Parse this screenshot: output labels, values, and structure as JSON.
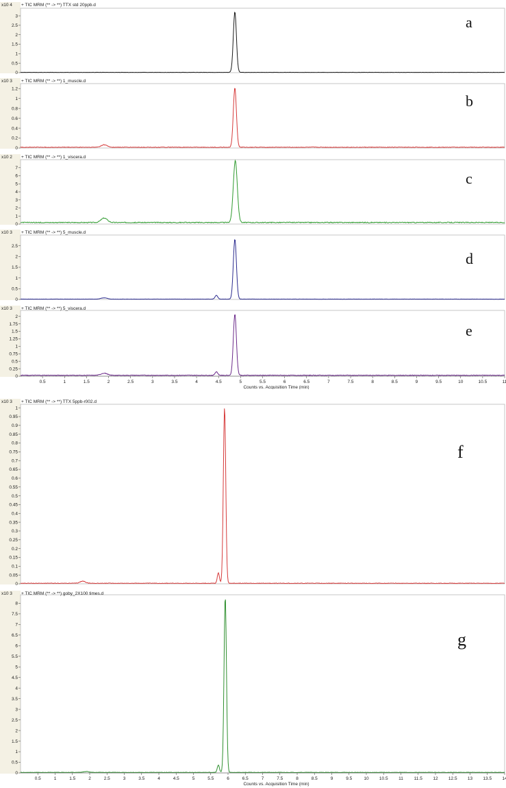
{
  "chart_data": [
    {
      "type": "line",
      "label": "a",
      "header": "+ TIC MRM (** -> **) TTX std 20ppb.d",
      "exponent": "x10 4",
      "y_ticks": [
        "0",
        "0.5",
        "1",
        "1.5",
        "2",
        "2.5",
        "3"
      ],
      "ylim": [
        0,
        3.4
      ],
      "xlim": [
        0,
        11
      ],
      "color": "#1a1a1a",
      "peaks": [
        {
          "x": 4.87,
          "y": 3.2,
          "w": 0.035
        }
      ],
      "baseline": 0.015,
      "noise": 0.006
    },
    {
      "type": "line",
      "label": "b",
      "header": "+ TIC MRM (** -> **) 1_muscle.d",
      "exponent": "x10 3",
      "y_ticks": [
        "0",
        "0.2",
        "0.4",
        "0.6",
        "0.8",
        "1",
        "1.2"
      ],
      "ylim": [
        0,
        1.3
      ],
      "xlim": [
        0,
        11
      ],
      "color": "#d63a3a",
      "peaks": [
        {
          "x": 1.9,
          "y": 0.05,
          "w": 0.07
        },
        {
          "x": 4.87,
          "y": 1.2,
          "w": 0.035
        }
      ],
      "baseline": 0.015,
      "noise": 0.006
    },
    {
      "type": "line",
      "label": "c",
      "header": "+ TIC MRM (** -> **) 1_viscera.d",
      "exponent": "x10 2",
      "y_ticks": [
        "0",
        "1",
        "2",
        "3",
        "4",
        "5",
        "6",
        "7"
      ],
      "ylim": [
        0,
        8
      ],
      "xlim": [
        0,
        11
      ],
      "color": "#2e9a2e",
      "peaks": [
        {
          "x": 1.9,
          "y": 0.55,
          "w": 0.07
        },
        {
          "x": 4.88,
          "y": 7.7,
          "w": 0.045
        }
      ],
      "baseline": 0.2,
      "noise": 0.05
    },
    {
      "type": "line",
      "label": "d",
      "header": "+ TIC MRM (** -> **) 5_muscle.d",
      "exponent": "x10 3",
      "y_ticks": [
        "0",
        "0.5",
        "1",
        "1.5",
        "2",
        "2.5"
      ],
      "ylim": [
        0,
        3.0
      ],
      "xlim": [
        0,
        11
      ],
      "color": "#2a2a8e",
      "peaks": [
        {
          "x": 1.9,
          "y": 0.06,
          "w": 0.07
        },
        {
          "x": 4.45,
          "y": 0.18,
          "w": 0.03
        },
        {
          "x": 4.87,
          "y": 2.8,
          "w": 0.035
        }
      ],
      "baseline": 0.015,
      "noise": 0.006
    },
    {
      "type": "line",
      "label": "e",
      "header": "+ TIC MRM (** -> **) 5_viscera.d",
      "exponent": "x10 3",
      "y_ticks": [
        "0",
        "0.25",
        "0.5",
        "0.75",
        "1",
        "1.25",
        "1.5",
        "1.75",
        "2"
      ],
      "ylim": [
        0,
        2.2
      ],
      "xlim": [
        0,
        11
      ],
      "color": "#6b2a8a",
      "peaks": [
        {
          "x": 1.9,
          "y": 0.07,
          "w": 0.07
        },
        {
          "x": 4.45,
          "y": 0.12,
          "w": 0.03
        },
        {
          "x": 4.87,
          "y": 2.05,
          "w": 0.035
        }
      ],
      "baseline": 0.03,
      "noise": 0.01,
      "x_ticks": [
        "0.5",
        "1",
        "1.5",
        "2",
        "2.5",
        "3",
        "3.5",
        "4",
        "4.5",
        "5",
        "5.5",
        "6",
        "6.5",
        "7",
        "7.5",
        "8",
        "8.5",
        "9",
        "9.5",
        "10",
        "10.5",
        "11"
      ],
      "xlabel": "Counts vs. Acquisition Time (min)"
    },
    {
      "type": "line",
      "label": "f",
      "header": "+ TIC MRM (** -> **) TTX 5ppb-r002.d",
      "exponent": "x10 3",
      "y_ticks": [
        "0",
        "0.05",
        "0.1",
        "0.15",
        "0.2",
        "0.25",
        "0.3",
        "0.35",
        "0.4",
        "0.45",
        "0.5",
        "0.55",
        "0.6",
        "0.65",
        "0.7",
        "0.75",
        "0.8",
        "0.85",
        "0.9",
        "0.95",
        "1"
      ],
      "ylim": [
        0,
        1.02
      ],
      "xlim": [
        0,
        14
      ],
      "color": "#d63a3a",
      "peaks": [
        {
          "x": 1.8,
          "y": 0.012,
          "w": 0.08
        },
        {
          "x": 5.72,
          "y": 0.06,
          "w": 0.03
        },
        {
          "x": 5.9,
          "y": 1.0,
          "w": 0.035
        }
      ],
      "baseline": 0.003,
      "noise": 0.0015
    },
    {
      "type": "line",
      "label": "g",
      "header": "+ TIC MRM (** -> **) goby_2X100 times.d",
      "exponent": "x10 3",
      "y_ticks": [
        "0",
        "0.5",
        "1",
        "1.5",
        "2",
        "2.5",
        "3",
        "3.5",
        "4",
        "4.5",
        "5",
        "5.5",
        "6",
        "6.5",
        "7",
        "7.5",
        "8"
      ],
      "ylim": [
        0,
        8.4
      ],
      "xlim": [
        0,
        14
      ],
      "color": "#2e8f2e",
      "peaks": [
        {
          "x": 1.9,
          "y": 0.04,
          "w": 0.08
        },
        {
          "x": 5.72,
          "y": 0.35,
          "w": 0.03
        },
        {
          "x": 5.92,
          "y": 8.3,
          "w": 0.035
        }
      ],
      "baseline": 0.025,
      "noise": 0.01,
      "x_ticks": [
        "0.5",
        "1",
        "1.5",
        "2",
        "2.5",
        "3",
        "3.5",
        "4",
        "4.5",
        "5",
        "5.5",
        "6",
        "6.5",
        "7",
        "7.5",
        "8",
        "8.5",
        "9",
        "9.5",
        "10",
        "10.5",
        "11",
        "11.5",
        "12",
        "12.5",
        "13",
        "13.5",
        "14"
      ],
      "xlabel": "Counts vs. Acquisition Time (min)"
    }
  ]
}
